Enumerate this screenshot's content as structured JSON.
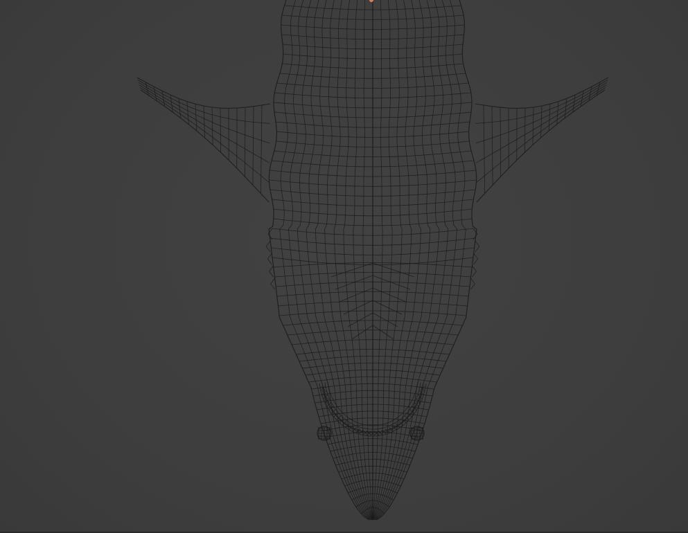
{
  "viewport": {
    "background": "#3f3f3f",
    "mode": "wireframe",
    "wire_color": "#1a1a1a"
  },
  "model": {
    "icon": "shark-wireframe-icon"
  },
  "origin": {
    "color": "#e07a5f"
  }
}
